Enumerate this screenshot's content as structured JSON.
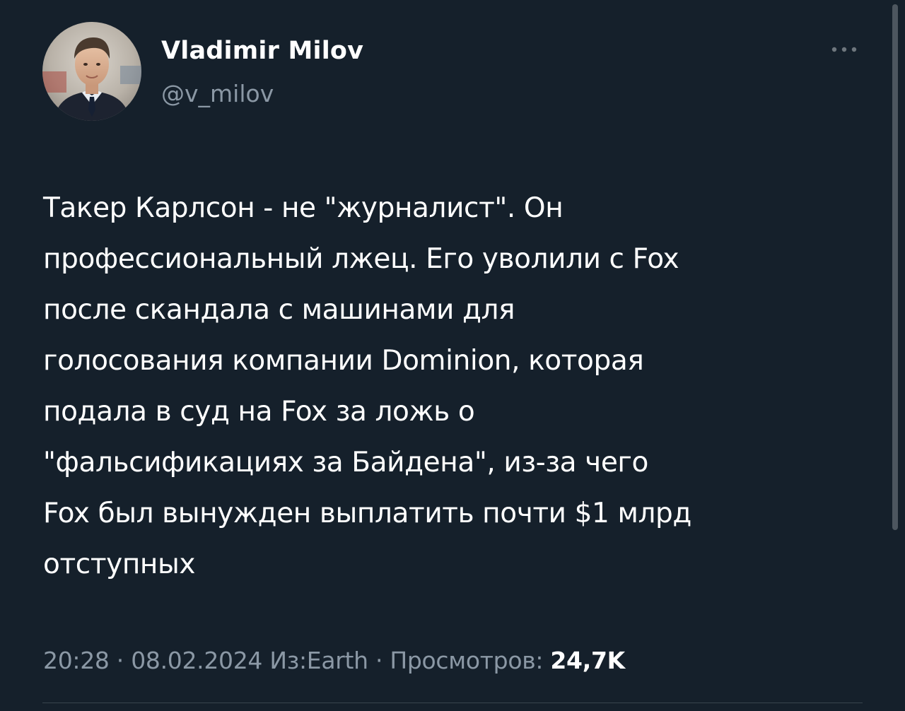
{
  "author": {
    "name": "Vladimir Milov",
    "handle": "@v_milov"
  },
  "tweet": {
    "lines": [
      "Такер Карлсон - не \"журналист\". Он",
      "профессиональный лжец. Его уволили с Fox",
      "после скандала с машинами для",
      "голосования компании Dominion, которая",
      "подала в суд на Fox за ложь о",
      "\"фальсификациях за Байдена\", из-за чего",
      "Fox был вынужден выплатить почти $1 млрд",
      "отступных"
    ]
  },
  "meta": {
    "time": "20:28",
    "separator": " · ",
    "date": "08.02.2024",
    "source": "Из:Earth",
    "views_label": "Просмотров:",
    "views_count": "24,7K"
  },
  "icons": {
    "more": "more-horizontal-icon",
    "avatar": "avatar-photo"
  },
  "colors": {
    "background": "#15202b",
    "primary_text": "#ffffff",
    "secondary_text": "#8b98a5",
    "divider": "#38444d"
  }
}
